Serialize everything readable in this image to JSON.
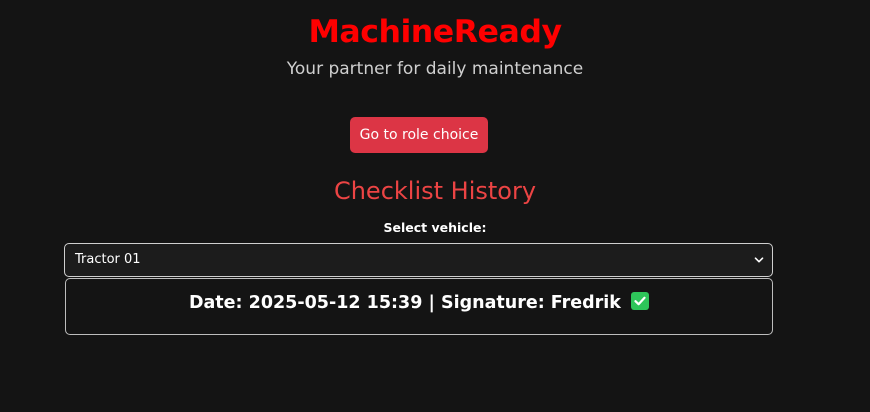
{
  "header": {
    "brand": "MachineReady",
    "tagline": "Your partner for daily maintenance"
  },
  "actions": {
    "role_choice_label": "Go to role choice"
  },
  "history": {
    "title": "Checklist History",
    "select_label": "Select vehicle:",
    "selected_vehicle": "Tractor 01",
    "entries": [
      {
        "date_label": "Date:",
        "date": "2025-05-12 15:39",
        "separator": "|",
        "signature_label": "Signature:",
        "signature": "Fredrik",
        "status_icon": "check-mark-icon"
      }
    ]
  },
  "colors": {
    "background": "#141414",
    "brand": "#ff0000",
    "accent_button": "#dc3545",
    "title": "#ec4444",
    "check": "#2ec55a"
  }
}
